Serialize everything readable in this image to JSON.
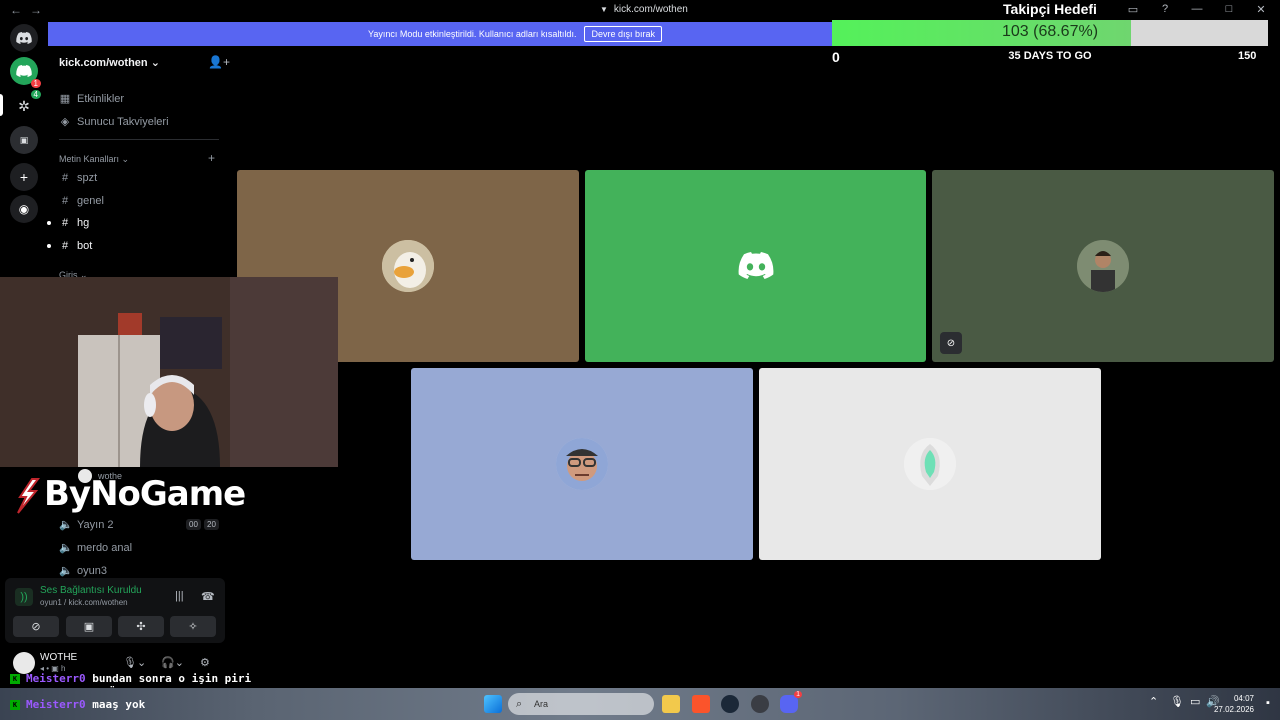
{
  "titlebar": {
    "back": "←",
    "forward": "→",
    "url": "kick.com/wothen"
  },
  "notice": {
    "text": "Yayıncı Modu etkinleştirildi. Kullanıcı adları kısaltıldı.",
    "button": "Devre dışı bırak"
  },
  "goal": {
    "title": "Takipçi Hedefi",
    "progress_text": "103 (68.67%)",
    "current": 103,
    "target": 150,
    "progress_fraction": 0.6867,
    "min_label": "0",
    "max_label": "150",
    "days_label": "35 DAYS TO GO"
  },
  "rail": {
    "badge_dm": "1",
    "badge_server": "4"
  },
  "sidebar": {
    "server_name": "kick.com/wothen",
    "events": "Etkinlikler",
    "boosts": "Sunucu Takviyeleri",
    "text_category": "Metin Kanalları",
    "channels": [
      "spzt",
      "genel",
      "hg",
      "bot"
    ],
    "partial_category": "Giriş",
    "voice_user": "wothe",
    "voice_channels": [
      "Yayın 2",
      "merdo anal",
      "oyun3"
    ],
    "stream_counts": [
      "00",
      "20"
    ]
  },
  "voice_panel": {
    "status": "Ses Bağlantısı Kuruldu",
    "sub": "oyun1 / kick.com/wothen"
  },
  "user_panel": {
    "name": "WOTHE",
    "status": "h"
  },
  "overlay": {
    "logo": "ByNoGame"
  },
  "chat": [
    {
      "user": "Meisterr0",
      "message": "bundan sonra o işin piri",
      "message2": "ömer"
    },
    {
      "user": "Meisterr0",
      "message": "maaş yok"
    }
  ],
  "taskbar": {
    "search_placeholder": "Ara",
    "time": "04:07",
    "date": "27.02.2026",
    "discord_badge": "1"
  },
  "colors": {
    "accent": "#5865f2",
    "tile_brown": "#7e6548",
    "tile_green": "#43b25a",
    "tile_olive": "#4a5a44",
    "tile_blue": "#97a9d4",
    "tile_light": "#e8e8e8",
    "goal_fill": "#54f15a"
  }
}
